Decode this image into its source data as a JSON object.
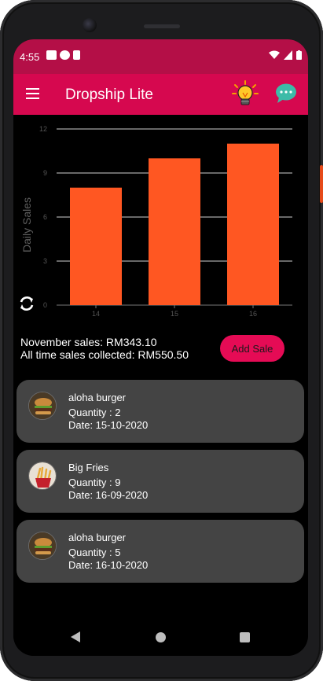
{
  "status_bar": {
    "time": "4:55"
  },
  "app_bar": {
    "title": "Dropship Lite"
  },
  "chart_data": {
    "type": "bar",
    "categories": [
      "14",
      "15",
      "16"
    ],
    "values": [
      8,
      10,
      11
    ],
    "ylabel": "Daily Sales",
    "yticks": [
      "0",
      "3",
      "6",
      "9",
      "12"
    ],
    "ylim": [
      0,
      12
    ],
    "grid": true,
    "bar_color": "#ff5722"
  },
  "summary": {
    "month_sales": "November sales: RM343.10",
    "all_time": "All time sales collected: RM550.50"
  },
  "add_sale_label": "Add Sale",
  "sales": [
    {
      "name": "aloha burger",
      "quantity": "Quantity : 2",
      "date": "Date: 15-10-2020",
      "icon": "burger-icon"
    },
    {
      "name": "Big Fries",
      "quantity": "Quantity : 9",
      "date": "Date: 16-09-2020",
      "icon": "fries-icon"
    },
    {
      "name": "aloha burger",
      "quantity": "Quantity : 5",
      "date": "Date: 16-10-2020",
      "icon": "burger-icon"
    }
  ],
  "colors": {
    "status_bar": "#b40f47",
    "app_bar": "#d6084f",
    "accent": "#e50b55",
    "card": "#444444",
    "bar": "#ff5722"
  }
}
